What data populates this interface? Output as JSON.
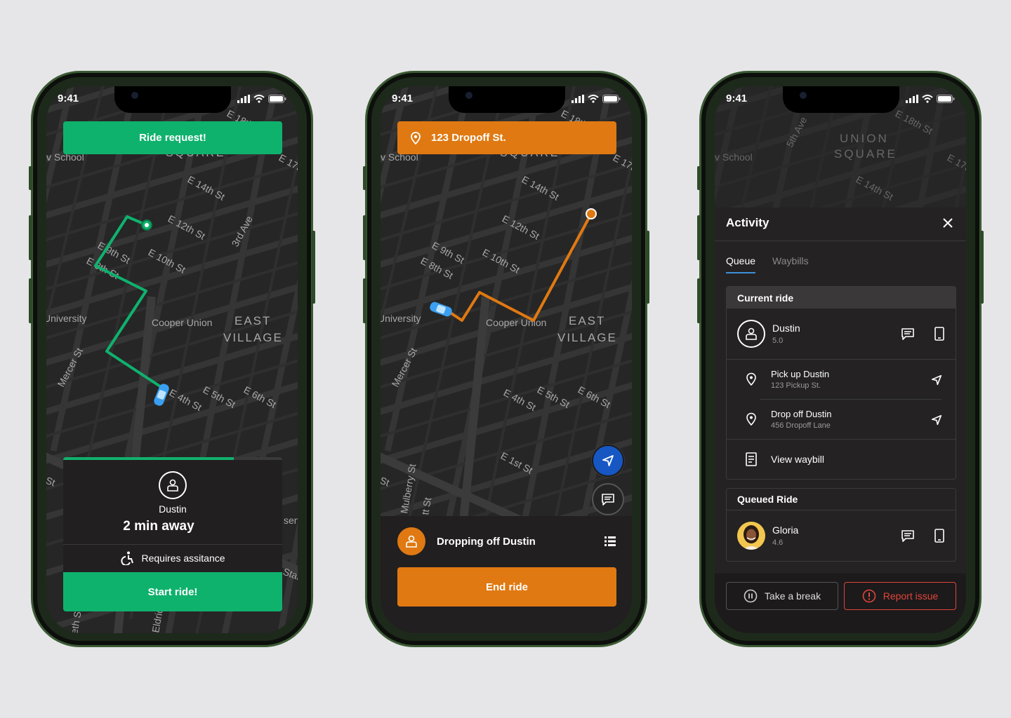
{
  "status": {
    "time": "9:41"
  },
  "map_labels": {
    "e18": "E 18th St",
    "e17": "E 17th",
    "school": "v School",
    "square": "SQUARE",
    "union": "UNION",
    "square2": "SQUARE",
    "fifth_ave": "5th Ave",
    "e14": "E 14th St",
    "e12": "E 12th St",
    "third_ave": "3rd Ave",
    "e9": "E 9th St",
    "e10": "E 10th St",
    "e8": "E 8th St",
    "university": "University",
    "cooper": "Cooper Union",
    "east": "EAST",
    "village": "VILLAGE",
    "mercer": "Mercer St",
    "e4": "E 4th St",
    "e5": "E 5th St",
    "e6": "E 6th St",
    "e1": "E 1st St",
    "mulberry": "Mulberry St",
    "st": "St",
    "sen": "sen",
    "star": "Star",
    "eldrid": "Eldrid",
    "eth": "eth St",
    "ttst": "tt St"
  },
  "phone1": {
    "banner": "Ride request!",
    "progress": 0.78,
    "rider_name": "Dustin",
    "eta": "2 min away",
    "assistance": "Requires assitance",
    "start_button": "Start ride!",
    "accent": "#0fb26d"
  },
  "phone2": {
    "banner": "123 Dropoff St.",
    "status_text": "Dropping off Dustin",
    "end_button": "End ride",
    "accent": "#e07912"
  },
  "phone3": {
    "title": "Activity",
    "tabs": [
      {
        "label": "Queue"
      },
      {
        "label": "Waybills"
      }
    ],
    "current_ride": {
      "header": "Current ride",
      "rider": {
        "name": "Dustin",
        "rating": "5.0"
      },
      "pickup": {
        "title": "Pick up Dustin",
        "address": "123 Pickup St."
      },
      "dropoff": {
        "title": "Drop off Dustin",
        "address": "456 Dropoff Lane"
      },
      "waybill": "View waybill"
    },
    "queued_ride": {
      "header": "Queued Ride",
      "rider": {
        "name": "Gloria",
        "rating": "4.6"
      }
    },
    "break_button": "Take a break",
    "report_button": "Report issue",
    "report_color": "#e0453c"
  }
}
